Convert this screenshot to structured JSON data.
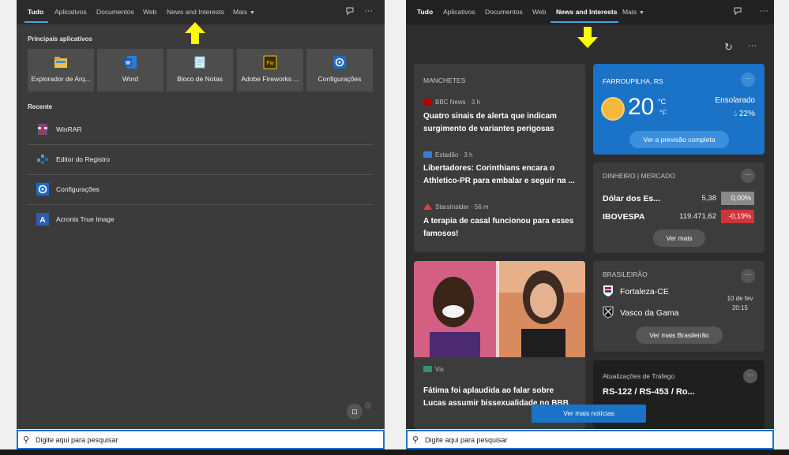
{
  "left": {
    "tabs": [
      {
        "label": "Tudo"
      },
      {
        "label": "Aplicativos"
      },
      {
        "label": "Documentos"
      },
      {
        "label": "Web"
      },
      {
        "label": "News and Interests"
      },
      {
        "label": "Mais"
      }
    ],
    "top_apps_label": "Principais aplicativos",
    "top_apps": [
      {
        "label": "Explorador de Arq...",
        "icon": "folder-icon"
      },
      {
        "label": "Word",
        "icon": "word-icon"
      },
      {
        "label": "Bloco de Notas",
        "icon": "notepad-icon"
      },
      {
        "label": "Adobe Fireworks ...",
        "icon": "fireworks-icon"
      },
      {
        "label": "Configurações",
        "icon": "gear-icon"
      }
    ],
    "recent_label": "Recente",
    "recent": [
      {
        "label": "WinRAR",
        "icon": "winrar-icon"
      },
      {
        "label": "Editor do Registro",
        "icon": "registry-icon"
      },
      {
        "label": "Configurações",
        "icon": "gear-icon"
      },
      {
        "label": "Acronis True Image",
        "icon": "acronis-icon"
      }
    ],
    "search_placeholder": "Digite aqui para pesquisar"
  },
  "right": {
    "tabs": [
      {
        "label": "Tudo"
      },
      {
        "label": "Aplicativos"
      },
      {
        "label": "Documentos"
      },
      {
        "label": "Web"
      },
      {
        "label": "News and Interests"
      },
      {
        "label": "Mais"
      }
    ],
    "headlines": {
      "title": "MANCHETES",
      "items": [
        {
          "source": "BBC News · 3 h",
          "headline": "Quatro sinais de alerta que indicam surgimento de variantes perigosas"
        },
        {
          "source": "Estadão · 3 h",
          "headline": "Libertadores: Corinthians encara o Athletico-PR para embalar e seguir na ..."
        },
        {
          "source": "StarsInsider · 56 m",
          "headline": "A terapia de casal funcionou para esses famosos!"
        }
      ]
    },
    "photo_story": {
      "source": "Vix",
      "headline": "Fátima foi aplaudida ao falar sobre Lucas assumir bissexualidade no BBB"
    },
    "weather": {
      "city": "FARROUPILHA, RS",
      "temp": "20",
      "unit_c": "°C",
      "unit_f": "°F",
      "condition": "Ensolarado",
      "humidity": "22%",
      "forecast_button": "Ver a previsão completa"
    },
    "market": {
      "title": "DINHEIRO | MERCADO",
      "rows": [
        {
          "name": "Dólar dos Es...",
          "value": "5,38",
          "change": "0,00%",
          "color": "#8a8a8a"
        },
        {
          "name": "IBOVESPA",
          "value": "119.471,62",
          "change": "-0,19%",
          "color": "#d13438"
        }
      ],
      "more_button": "Ver mais"
    },
    "sports": {
      "title": "BRASILEIRÃO",
      "team_home": "Fortaleza-CE",
      "team_away": "Vasco da Gama",
      "date": "10 de fev",
      "time": "20:15",
      "more_button": "Ver mais Brasileirão"
    },
    "traffic": {
      "title": "Atualizações de Tráfego",
      "road": "RS-122 / RS-453 / Ro..."
    },
    "more_news_button": "Ver mais notícias",
    "search_placeholder": "Digite aqui para pesquisar"
  },
  "colors": {
    "accent": "#1f6fd0",
    "arrow": "#ffff00",
    "weather_bg": "#1a73c7",
    "negative": "#d13438"
  }
}
